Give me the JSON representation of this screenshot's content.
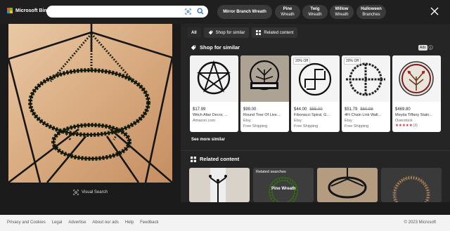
{
  "header": {
    "logo_text": "Microsoft Bing",
    "search_value": "",
    "chips": [
      {
        "line1": "Mirror Branch Wreath",
        "line2": ""
      },
      {
        "line1": "Pine",
        "line2": "Wreath"
      },
      {
        "line1": "Twig",
        "line2": "Wreath"
      },
      {
        "line1": "Willow",
        "line2": "Wreath"
      },
      {
        "line1": "Halloween",
        "line2": "Branches"
      }
    ]
  },
  "left": {
    "visual_search_label": "Visual Search"
  },
  "right": {
    "tabs": [
      {
        "label": "All"
      },
      {
        "label": "Shop for similar"
      },
      {
        "label": "Related content"
      }
    ],
    "shop_title": "Shop for similar",
    "ads_label": "Ads",
    "products": [
      {
        "price": "$17.99",
        "old_price": "",
        "badge": "",
        "title": "Witch Altar Decor, ...",
        "source": "Amazon.com",
        "shipping": ""
      },
      {
        "price": "$99.00",
        "old_price": "",
        "badge": "",
        "title": "Round Tree Of Live...",
        "source": "Etsy",
        "shipping": "Free Shipping"
      },
      {
        "price": "$44.00",
        "old_price": "$55.00",
        "badge": "20% Off",
        "title": "Fibonacci Spiral, G...",
        "source": "Etsy",
        "shipping": "Free Shipping"
      },
      {
        "price": "$51.79",
        "old_price": "$60.98",
        "badge": "20% Off",
        "title": "4Ft Chain Link Wall...",
        "source": "Etsy",
        "shipping": "Free Shipping"
      },
      {
        "price": "$469.80",
        "old_price": "",
        "badge": "",
        "title": "Meyda Tiffany Stain...",
        "source": "Overstock",
        "shipping": "",
        "rating_count": "(3)",
        "stars": 5
      }
    ],
    "see_more_label": "See more similar",
    "related_title": "Related content",
    "related_searches_label": "Related searches",
    "related_caption": "Pine Wreath"
  },
  "footer": {
    "links": [
      "Privacy and Cookies",
      "Legal",
      "Advertise",
      "About our ads",
      "Help",
      "Feedback"
    ],
    "copyright": "© 2023 Microsoft"
  },
  "colors": {
    "background": "#1b1b1b",
    "panel": "#252525",
    "chip": "#3a3a3a",
    "star": "#e22222"
  }
}
